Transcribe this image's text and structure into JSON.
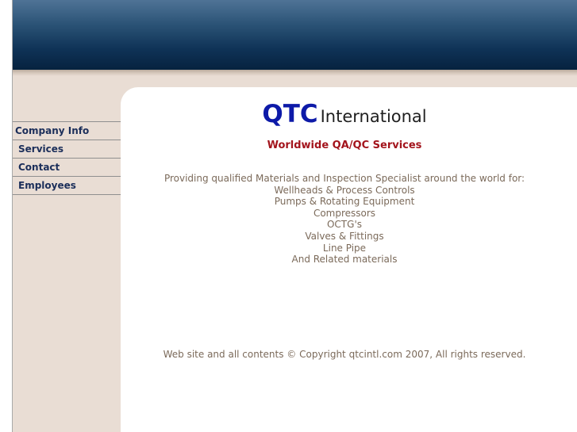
{
  "nav": {
    "items": [
      {
        "label": "Company Info"
      },
      {
        "label": "Services"
      },
      {
        "label": "Contact"
      },
      {
        "label": "Employees"
      }
    ]
  },
  "logo": {
    "brand": "QTC",
    "suffix": "International"
  },
  "tagline": "Worldwide QA/QC Services",
  "intro": {
    "lead": "Providing qualified Materials and Inspection Specialist around the world for:",
    "items": [
      "Wellheads & Process Controls",
      "Pumps & Rotating Equipment",
      "Compressors",
      "OCTG's",
      "Valves & Fittings",
      "Line Pipe",
      "And Related materials"
    ]
  },
  "footer": "Web site and all contents © Copyright qtcintl.com 2007, All rights reserved.",
  "colors": {
    "brand_blue": "#0d1aa8",
    "tagline_red": "#a3141c",
    "text_brown": "#7b6a5a",
    "nav_text": "#1b2e5a",
    "sidebar_bg": "#e9ddd4",
    "banner_dark": "#06223f"
  }
}
